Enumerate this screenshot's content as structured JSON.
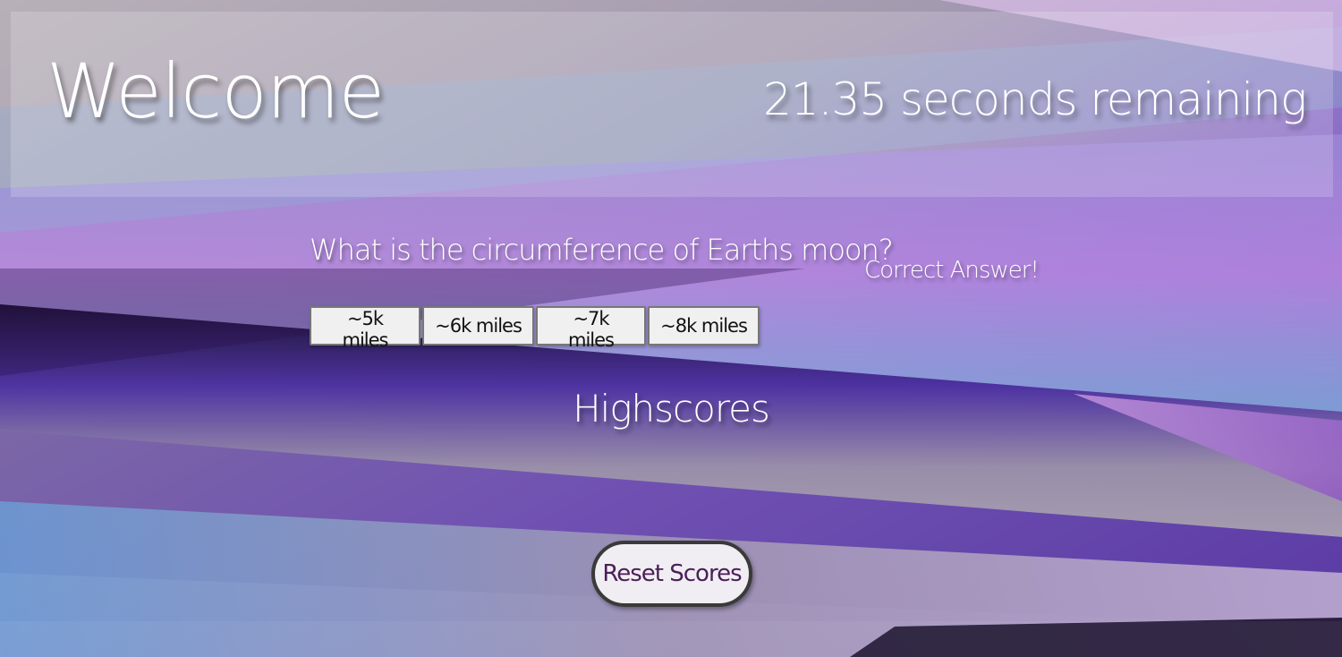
{
  "header": {
    "title": "Welcome",
    "timer_value": "21.35",
    "timer_suffix": "seconds remaining"
  },
  "quiz": {
    "question": "What is the circumference of Earths moon?",
    "feedback": "Correct Answer!",
    "answers": [
      {
        "label": "~5k miles"
      },
      {
        "label": "~6k miles"
      },
      {
        "label": "~7k miles"
      },
      {
        "label": "~8k miles"
      }
    ]
  },
  "highscores": {
    "heading": "Highscores",
    "entries": []
  },
  "actions": {
    "reset_label": "Reset Scores"
  },
  "colors": {
    "purple_deep": "#3b1f8c",
    "lavender": "#c48ed8",
    "sky_blue": "#79a7d6",
    "grey_mauve": "#a89aa8",
    "reset_text": "#4a1f58"
  }
}
